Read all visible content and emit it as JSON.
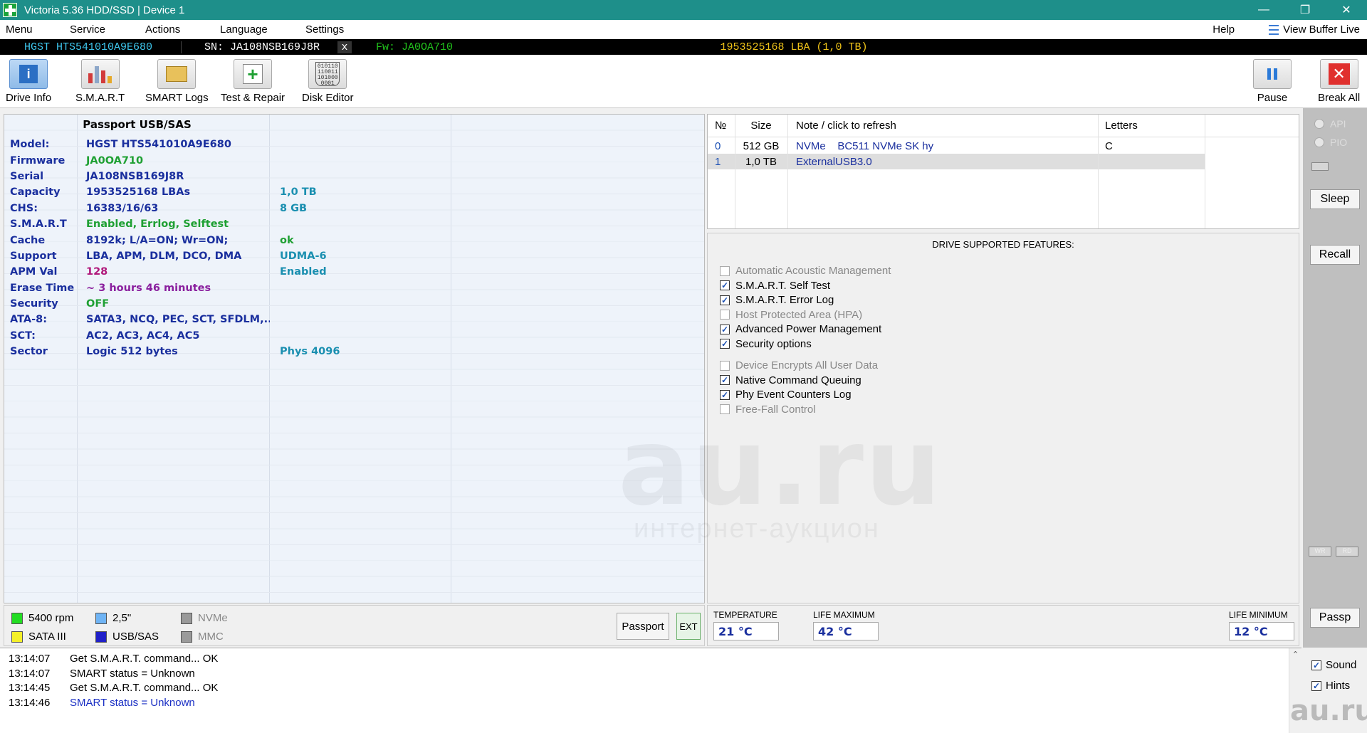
{
  "window": {
    "title": "Victoria 5.36 HDD/SSD | Device 1",
    "controls": [
      "—",
      "❐",
      "✕"
    ]
  },
  "menu": {
    "items": [
      "Menu",
      "Service",
      "Actions",
      "Language",
      "Settings"
    ],
    "help": "Help",
    "view_buffer": "View Buffer Live"
  },
  "infostrip": {
    "model": "HGST HTS541010A9E680",
    "serial": "SN: JA108NSB169J8R",
    "close": "x",
    "firmware": "Fw: JA0OA710",
    "lba": "1953525168 LBA (1,0 TB)"
  },
  "toolbar": {
    "drive_info": "Drive Info",
    "smart": "S.M.A.R.T",
    "smart_logs": "SMART Logs",
    "test_repair": "Test & Repair",
    "disk_editor": "Disk Editor",
    "pause": "Pause",
    "break_all": "Break All",
    "disk_editor_icon_text": "010110 110011 101000 0001"
  },
  "drive_info": {
    "header": "Passport USB/SAS",
    "rows": [
      {
        "key": "Model:",
        "value": "HGST HTS541010A9E680",
        "extra": ""
      },
      {
        "key": "Firmware",
        "value": "JA0OA710",
        "extra": ""
      },
      {
        "key": "Serial",
        "value": "JA108NSB169J8R",
        "extra": ""
      },
      {
        "key": "Capacity",
        "value": "1953525168 LBAs",
        "extra": "1,0 TB"
      },
      {
        "key": "CHS:",
        "value": "16383/16/63",
        "extra": "8 GB"
      },
      {
        "key": "S.M.A.R.T",
        "value": "Enabled, Errlog, Selftest",
        "extra": ""
      },
      {
        "key": "Cache",
        "value": "8192k; L/A=ON; Wr=ON;",
        "extra": "ok"
      },
      {
        "key": "Support",
        "value": "LBA, APM, DLM, DCO, DMA",
        "extra": "UDMA-6"
      },
      {
        "key": "APM Val",
        "value": "128",
        "extra": "Enabled"
      },
      {
        "key": "Erase Time",
        "value": "~ 3 hours 46 minutes",
        "extra": ""
      },
      {
        "key": "Security",
        "value": "OFF",
        "extra": ""
      },
      {
        "key": "ATA-8:",
        "value": "SATA3, NCQ, PEC, SCT, SFDLM,...",
        "extra": ""
      },
      {
        "key": "SCT:",
        "value": "AC2, AC3, AC4, AC5",
        "extra": ""
      },
      {
        "key": "Sector",
        "value": "Logic 512 bytes",
        "extra": "Phys 4096"
      }
    ],
    "value_colors": {
      "Firmware": "#1fa033",
      "S.M.A.R.T": "#1fa033",
      "Security": "#1fa033",
      "APM Val": "#b0177a",
      "Erase Time": "#8a1f9e",
      "ok_extra": "#1fa033"
    }
  },
  "legend": {
    "rpm": "5400 rpm",
    "size": "2,5\"",
    "nvme": "NVMe",
    "sata": "SATA III",
    "usb": "USB/SAS",
    "mmc": "MMC",
    "colors": {
      "rpm": "#22dd22",
      "size": "#6fb4f5",
      "nvme": "#9a9a9a",
      "sata": "#f4f028",
      "usb": "#2020c8",
      "mmc": "#9a9a9a"
    }
  },
  "bottom_buttons": {
    "passport": "Passport",
    "ext": "EXT"
  },
  "partitions": {
    "headers": [
      "№",
      "Size",
      "Note / click to refresh",
      "Letters"
    ],
    "rows": [
      {
        "num": "0",
        "size": "512 GB",
        "note": "NVMe    BC511 NVMe SK hy",
        "letter": "C"
      },
      {
        "num": "1",
        "size": "1,0 TB",
        "note": "ExternalUSB3.0",
        "letter": ""
      }
    ]
  },
  "features": {
    "title": "DRIVE SUPPORTED FEATURES:",
    "items": [
      {
        "label": "Automatic Acoustic Management",
        "checked": false
      },
      {
        "label": "S.M.A.R.T. Self Test",
        "checked": true
      },
      {
        "label": "S.M.A.R.T. Error Log",
        "checked": true
      },
      {
        "label": "Host Protected Area (HPA)",
        "checked": false
      },
      {
        "label": "Advanced Power Management",
        "checked": true
      },
      {
        "label": "Security options",
        "checked": true
      },
      {
        "label": "Device Encrypts All User Data",
        "checked": false
      },
      {
        "label": "Native Command Queuing",
        "checked": true
      },
      {
        "label": "Phy Event Counters Log",
        "checked": true
      },
      {
        "label": "Free-Fall Control",
        "checked": false
      }
    ]
  },
  "temperature": {
    "temp_label": "TEMPERATURE",
    "temp_value": "21 °C",
    "life_max_label": "LIFE MAXIMUM",
    "life_max_value": "42 °C",
    "life_min_label": "LIFE MINIMUM",
    "life_min_value": "12 °C"
  },
  "right_panel": {
    "api": "API",
    "pio": "PIO",
    "sleep": "Sleep",
    "recall": "Recall",
    "wr": "WR",
    "rd": "RD",
    "passp": "Passp"
  },
  "log": [
    {
      "time": "13:14:07",
      "msg": "Get S.M.A.R.T. command... OK",
      "highlight": false
    },
    {
      "time": "13:14:07",
      "msg": "SMART status = Unknown",
      "highlight": false
    },
    {
      "time": "13:14:45",
      "msg": "Get S.M.A.R.T. command... OK",
      "highlight": false
    },
    {
      "time": "13:14:46",
      "msg": "SMART status = Unknown",
      "highlight": true
    }
  ],
  "options": {
    "sound": "Sound",
    "hints": "Hints"
  },
  "watermark": {
    "logo": "au.ru",
    "tagline": "интернет-аукцион",
    "corner": "au.ru"
  }
}
